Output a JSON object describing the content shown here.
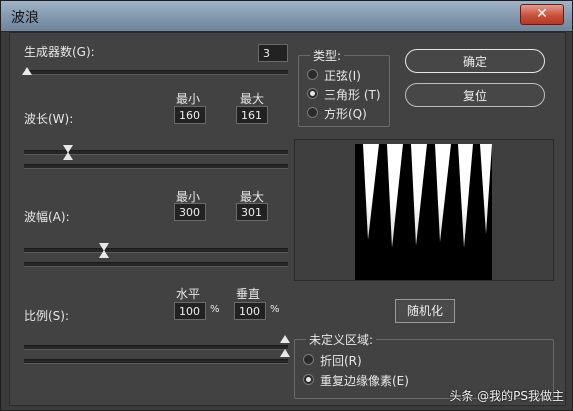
{
  "window": {
    "title": "波浪",
    "close_glyph": "✕"
  },
  "generators": {
    "label": "生成器数(G):",
    "value": "3"
  },
  "wavelength": {
    "label": "波长(W):",
    "min_header": "最小",
    "max_header": "最大",
    "min": "160",
    "max": "161"
  },
  "amplitude": {
    "label": "波幅(A):",
    "min_header": "最小",
    "max_header": "最大",
    "min": "300",
    "max": "301"
  },
  "scale": {
    "label": "比例(S):",
    "h_header": "水平",
    "v_header": "垂直",
    "h": "100",
    "v": "100",
    "unit": "%"
  },
  "type": {
    "title": "类型:",
    "options": [
      {
        "label": "正弦(I)",
        "checked": false
      },
      {
        "label": "三角形 (T)",
        "checked": true
      },
      {
        "label": "方形(Q)",
        "checked": false
      }
    ]
  },
  "buttons": {
    "ok": "确定",
    "reset": "复位",
    "randomize": "随机化"
  },
  "undefined_areas": {
    "title": "未定义区域:",
    "options": [
      {
        "label": "折回(R)",
        "checked": false
      },
      {
        "label": "重复边缘像素(E)",
        "checked": true
      }
    ]
  },
  "watermark": "头条 @我的PS我做主",
  "sliders": {
    "generators": 0.0,
    "wavelength_min": 0.16,
    "wavelength_max": 0.16,
    "amplitude_min": 0.3,
    "amplitude_max": 0.3,
    "scale_h": 1.0,
    "scale_v": 1.0
  }
}
